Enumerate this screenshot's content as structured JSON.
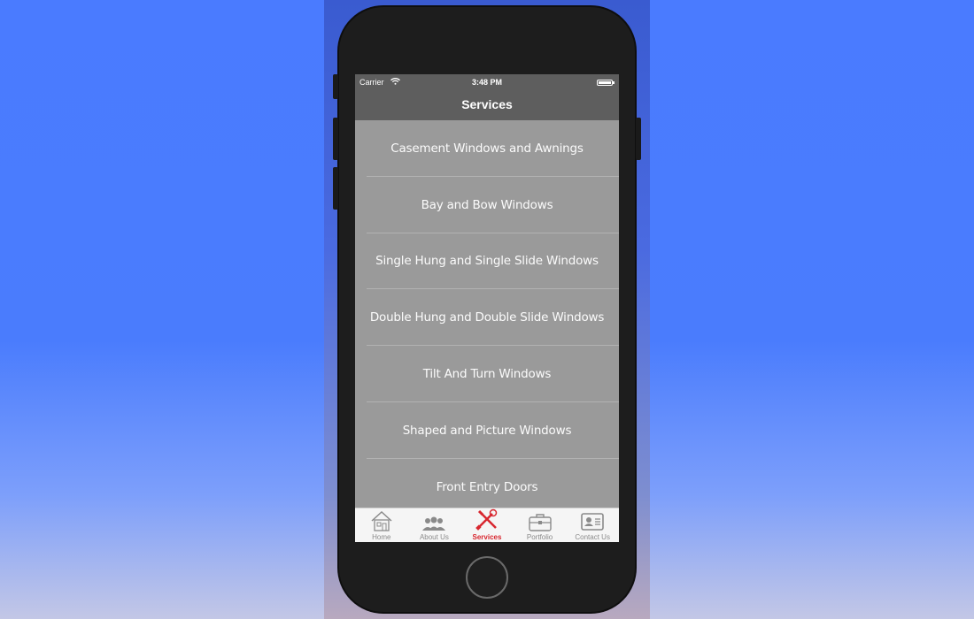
{
  "status_bar": {
    "carrier": "Carrier",
    "time": "3:48 PM"
  },
  "nav": {
    "title": "Services"
  },
  "services": [
    "Casement Windows and Awnings",
    "Bay and Bow Windows",
    "Single Hung and Single Slide Windows",
    "Double Hung and Double Slide Windows",
    "Tilt And Turn Windows",
    "Shaped and Picture Windows",
    "Front Entry Doors"
  ],
  "tabs": [
    {
      "label": "Home",
      "icon": "house-icon"
    },
    {
      "label": "About Us",
      "icon": "people-icon"
    },
    {
      "label": "Services",
      "icon": "tools-icon",
      "active": true
    },
    {
      "label": "Portfolio",
      "icon": "briefcase-icon"
    },
    {
      "label": "Contact Us",
      "icon": "contact-card-icon"
    }
  ],
  "colors": {
    "active_tab": "#d8262e",
    "nav_bg": "#5e5e5e",
    "list_bg": "#9a9a9a"
  }
}
